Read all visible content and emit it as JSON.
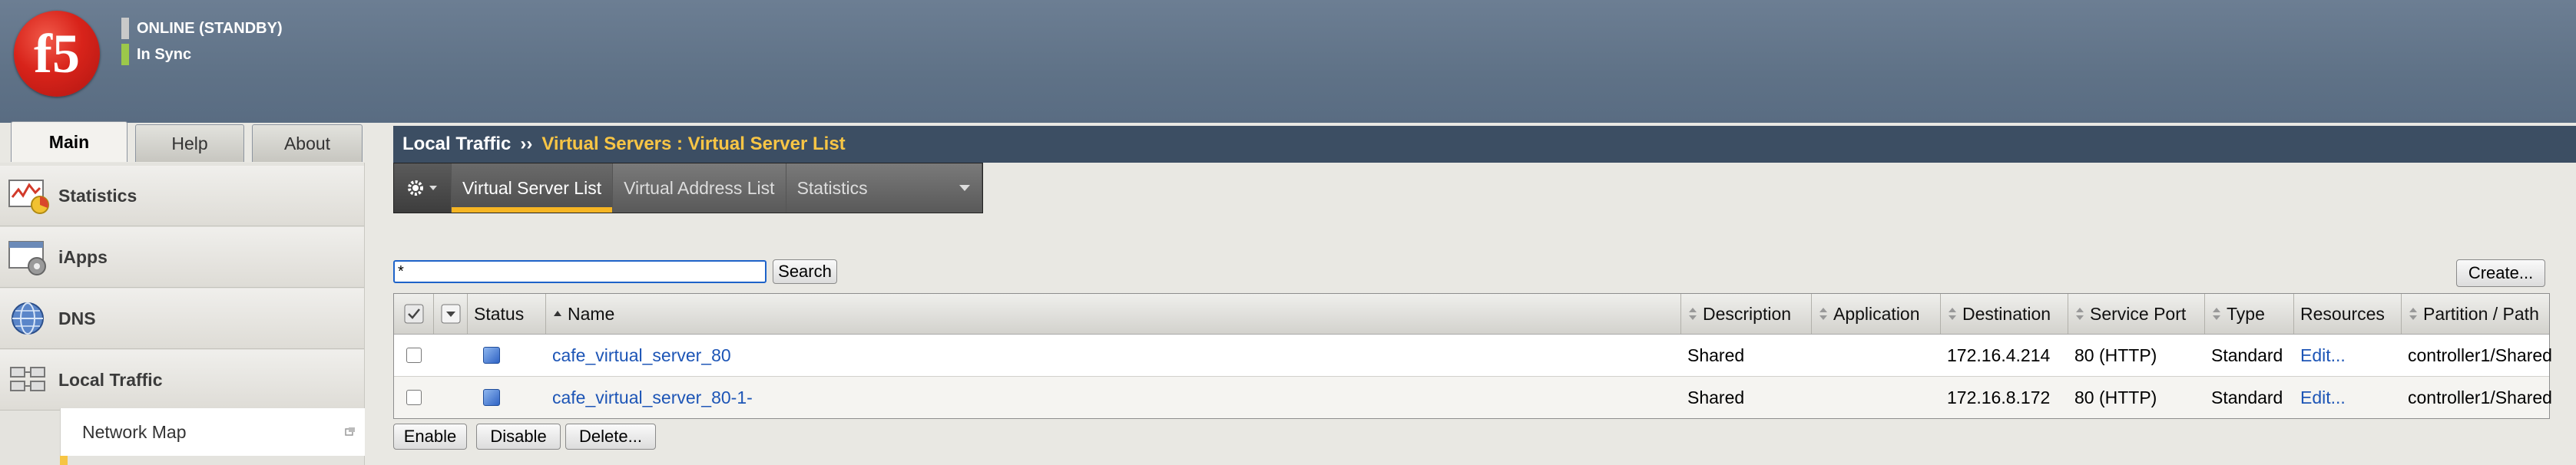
{
  "header": {
    "status_online": "ONLINE (STANDBY)",
    "status_sync": "In Sync",
    "status_online_color": "#c9c9c9",
    "status_sync_color": "#9cc84a",
    "logo_text": "f5"
  },
  "main_tabs": [
    {
      "label": "Main",
      "active": true
    },
    {
      "label": "Help",
      "active": false
    },
    {
      "label": "About",
      "active": false
    }
  ],
  "sidebar": {
    "items": [
      {
        "label": "Statistics",
        "icon": "statistics-icon"
      },
      {
        "label": "iApps",
        "icon": "iapps-icon"
      },
      {
        "label": "DNS",
        "icon": "dns-globe-icon"
      },
      {
        "label": "Local Traffic",
        "icon": "local-traffic-icon"
      }
    ],
    "sub_item": "Network Map"
  },
  "breadcrumb": {
    "section": "Local Traffic",
    "separator": "››",
    "page": "Virtual Servers : Virtual Server List"
  },
  "toolbar": {
    "tabs": [
      {
        "label": "Virtual Server List",
        "active": true
      },
      {
        "label": "Virtual Address List",
        "active": false
      },
      {
        "label": "Statistics",
        "active": false,
        "dropdown": true
      }
    ]
  },
  "search": {
    "value": "*",
    "button": "Search"
  },
  "create_button": "Create...",
  "table": {
    "columns": [
      "Status",
      "Name",
      "Description",
      "Application",
      "Destination",
      "Service Port",
      "Type",
      "Resources",
      "Partition / Path"
    ],
    "rows": [
      {
        "name": "cafe_virtual_server_80",
        "description": "Shared",
        "application": "",
        "destination": "172.16.4.214",
        "service_port": "80 (HTTP)",
        "type": "Standard",
        "resources": "Edit...",
        "partition": "controller1/Shared"
      },
      {
        "name": "cafe_virtual_server_80-1-",
        "description": "Shared",
        "application": "",
        "destination": "172.16.8.172",
        "service_port": "80 (HTTP)",
        "type": "Standard",
        "resources": "Edit...",
        "partition": "controller1/Shared"
      }
    ]
  },
  "actions": {
    "enable": "Enable",
    "disable": "Disable",
    "delete": "Delete..."
  },
  "colors": {
    "header_bg": "#5f7287",
    "breadcrumb_bg": "#3c4e63",
    "breadcrumb_accent": "#f8c545",
    "active_tab_underline": "#f6b523",
    "link": "#1d55b6"
  }
}
